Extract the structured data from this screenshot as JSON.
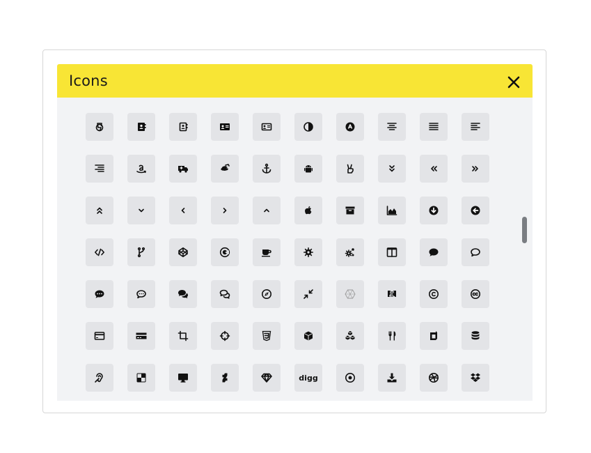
{
  "dialog": {
    "title": "Icons"
  },
  "icons": [
    "html5-icon",
    "address-book-icon",
    "address-book-outline-icon",
    "address-card-icon",
    "address-card-outline-icon",
    "adjust-icon",
    "angellist-icon",
    "align-center-icon",
    "align-justify-icon",
    "align-left-icon",
    "align-right-icon",
    "amazon-icon",
    "ambulance-icon",
    "american-sign-language-icon",
    "anchor-icon",
    "android-icon",
    "hand-peace-icon",
    "angle-double-down-icon",
    "angle-double-left-icon",
    "angle-double-right-icon",
    "angle-double-up-icon",
    "angle-down-icon",
    "angle-left-icon",
    "angle-right-icon",
    "angle-up-icon",
    "apple-icon",
    "archive-icon",
    "area-chart-icon",
    "arrow-circle-down-icon",
    "arrow-circle-left-icon",
    "code-icon",
    "code-fork-icon",
    "codepen-icon",
    "codiepie-icon",
    "coffee-icon",
    "cog-icon",
    "cogs-icon",
    "columns-icon",
    "comment-icon",
    "comment-outline-icon",
    "commenting-icon",
    "commenting-outline-icon",
    "comments-icon",
    "comments-outline-icon",
    "compass-icon",
    "compress-icon",
    "connectdevelop-icon",
    "contao-icon",
    "copyright-icon",
    "creative-commons-icon",
    "credit-card-icon",
    "credit-card-alt-icon",
    "crop-icon",
    "crosshairs-icon",
    "css3-icon",
    "cube-icon",
    "cubes-icon",
    "cutlery-icon",
    "dashcube-icon",
    "database-icon",
    "deaf-icon",
    "delicious-icon",
    "desktop-icon",
    "deviantart-icon",
    "diamond-icon",
    "digg-icon",
    "dot-circle-icon",
    "download-icon",
    "dribbble-icon",
    "dropbox-icon"
  ],
  "digg_label": "digg"
}
